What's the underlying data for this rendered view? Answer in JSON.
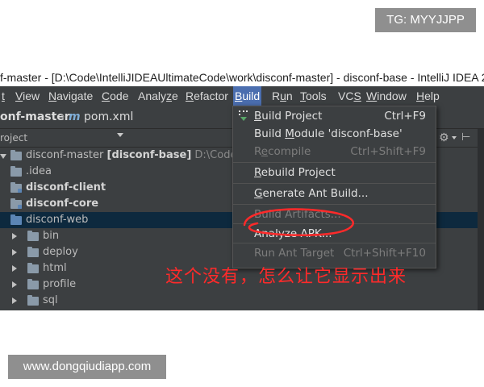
{
  "watermarks": {
    "top": "TG: MYYJJPP",
    "bottom": "www.dongqiudiapp.com"
  },
  "window": {
    "title": "f-master - [D:\\Code\\IntelliJIDEAUltimateCode\\work\\disconf-master] - disconf-base - IntelliJ IDEA 20"
  },
  "menubar": {
    "items": [
      {
        "pre": "",
        "u": "t",
        "post": ""
      },
      {
        "pre": "",
        "u": "V",
        "post": "iew"
      },
      {
        "pre": "",
        "u": "N",
        "post": "avigate"
      },
      {
        "pre": "",
        "u": "C",
        "post": "ode"
      },
      {
        "pre": "Analy",
        "u": "z",
        "post": "e"
      },
      {
        "pre": "",
        "u": "R",
        "post": "efactor"
      },
      {
        "pre": "",
        "u": "B",
        "post": "uild"
      },
      {
        "pre": "R",
        "u": "u",
        "post": "n"
      },
      {
        "pre": "",
        "u": "T",
        "post": "ools"
      },
      {
        "pre": "VC",
        "u": "S",
        "post": ""
      },
      {
        "pre": "",
        "u": "W",
        "post": "indow"
      },
      {
        "pre": "",
        "u": "H",
        "post": "elp"
      }
    ]
  },
  "navbar": {
    "root": "onf-master",
    "separator": "›",
    "m": "m",
    "file": "pom.xml"
  },
  "toolrow": {
    "project": "roject",
    "gear": "⚙",
    "pin": "⊢"
  },
  "tree": {
    "root": {
      "name": "disconf-master",
      "module": "[disconf-base]",
      "path": "D:\\Code\\IntelliJ"
    },
    "items": [
      {
        "name": ".idea"
      },
      {
        "name": "disconf-client"
      },
      {
        "name": "disconf-core"
      },
      {
        "name": "disconf-web"
      },
      {
        "name": "bin"
      },
      {
        "name": "deploy"
      },
      {
        "name": "html"
      },
      {
        "name": "profile"
      },
      {
        "name": "sql"
      }
    ]
  },
  "build_menu": {
    "items": [
      {
        "pre": "",
        "u": "B",
        "post": "uild Project",
        "shortcut": "Ctrl+F9"
      },
      {
        "pre": "Build ",
        "u": "M",
        "post": "odule 'disconf-base'",
        "shortcut": ""
      },
      {
        "pre": "R",
        "u": "e",
        "post": "compile",
        "shortcut": "Ctrl+Shift+F9"
      },
      {
        "pre": "",
        "u": "R",
        "post": "ebuild Project",
        "shortcut": ""
      },
      {
        "pre": "",
        "u": "G",
        "post": "enerate Ant Build...",
        "shortcut": ""
      },
      {
        "pre": "Build Artifacts...",
        "u": "",
        "post": "",
        "shortcut": ""
      },
      {
        "pre": "Analyze APK...",
        "u": "",
        "post": "",
        "shortcut": ""
      },
      {
        "pre": "Run Ant Target",
        "u": "",
        "post": "",
        "shortcut": "Ctrl+Shift+F10"
      }
    ]
  },
  "annotation": {
    "text": "这个没有，怎么让它显示出来"
  },
  "colors": {
    "accent": "#4b6eaf",
    "annotation": "#ff2a2a",
    "background": "#3c3f41"
  }
}
